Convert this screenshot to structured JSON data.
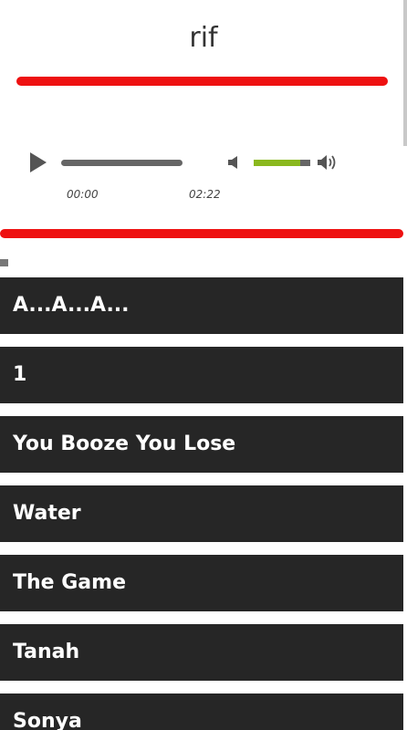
{
  "title": "rif",
  "colors": {
    "accent_red": "#ee1111",
    "volume_green": "#8ab81e",
    "list_bg": "#262626"
  },
  "player": {
    "current_time": "00:00",
    "total_time": "02:22",
    "progress_fraction": 0,
    "volume_fraction": 0.82,
    "icons": {
      "play": "play-icon",
      "mute": "speaker-mute-icon",
      "max": "speaker-volume-icon"
    }
  },
  "tracks": [
    "A...A...A...",
    "1",
    "You Booze You Lose",
    "Water",
    "The Game",
    "Tanah",
    "Sonya"
  ]
}
